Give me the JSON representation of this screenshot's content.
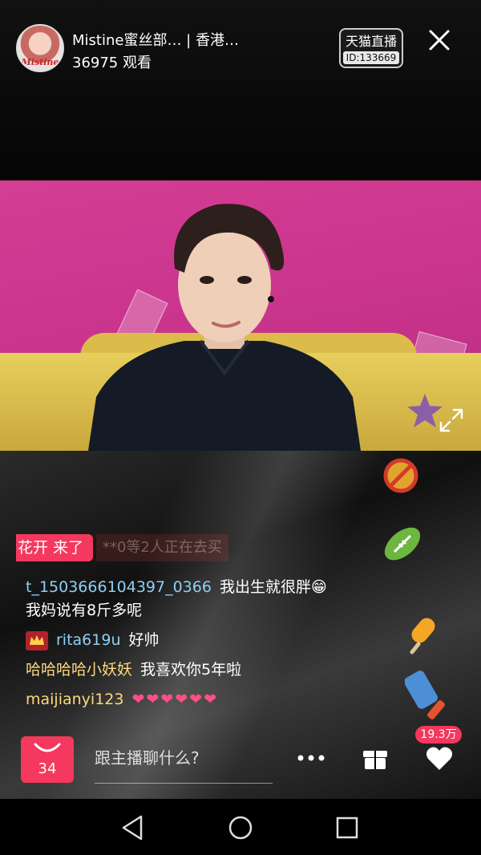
{
  "header": {
    "room_title": "Mistine蜜丝部…  |  香港…",
    "viewer_count": "36975 观看",
    "avatar_logo": "Mistine",
    "platform_badge": "天猫直播",
    "platform_id": "ID:133669"
  },
  "feed": {
    "welcome_tag": "花开 来了",
    "welcome_ghost": "**0等2人正在去买",
    "comments": [
      {
        "user": "t_1503666104397_0366",
        "text": "我出生就很胖😁我妈说有8斤多呢",
        "user_color": "#8fd0f2"
      },
      {
        "user": "rita619u",
        "text": "好帅",
        "badge": "crown",
        "user_color": "#8fd0f2"
      },
      {
        "user": "哈哈哈哈小妖妖",
        "text": "我喜欢你5年啦",
        "user_color": "#ffd97a"
      },
      {
        "user": "maijianyi123",
        "text": "❤❤❤❤❤❤",
        "user_color": "#ffd97a",
        "text_color": "#ff4f83"
      }
    ]
  },
  "bottom": {
    "bag_count": "34",
    "chat_placeholder": "跟主播聊什么?",
    "like_count": "19.3万"
  },
  "icons": [
    "close-icon",
    "expand-icon",
    "shopping-bag-icon",
    "more-icon",
    "gift-icon",
    "heart-icon",
    "back-icon",
    "home-icon",
    "recents-icon"
  ],
  "colors": {
    "accent": "#f5385d",
    "user_blue": "#8fd0f2",
    "user_gold": "#ffd97a"
  }
}
